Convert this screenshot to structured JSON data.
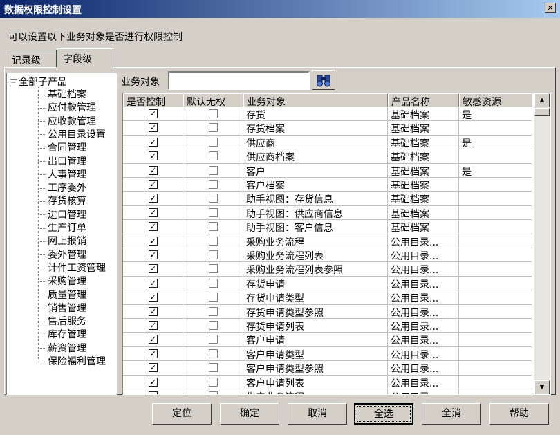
{
  "window": {
    "title": "数据权限控制设置",
    "close_glyph": "✕"
  },
  "description": "可以设置以下业务对象是否进行权限控制",
  "tabs": [
    {
      "label": "记录级"
    },
    {
      "label": "字段级"
    }
  ],
  "tree": {
    "root": "全部子产品",
    "expander": "−",
    "items": [
      "基础档案",
      "应付款管理",
      "应收款管理",
      "公用目录设置",
      "合同管理",
      "出口管理",
      "人事管理",
      "工序委外",
      "存货核算",
      "进口管理",
      "生产订单",
      "网上报销",
      "委外管理",
      "计件工资管理",
      "采购管理",
      "质量管理",
      "销售管理",
      "售后服务",
      "库存管理",
      "薪资管理",
      "保险福利管理"
    ]
  },
  "search": {
    "label": "业务对象",
    "value": "",
    "icon": "binoculars-icon"
  },
  "grid": {
    "headers": [
      "是否控制",
      "默认无权",
      "业务对象",
      "产品名称",
      "敏感资源"
    ],
    "rows": [
      {
        "control": true,
        "deny": false,
        "object": "存货",
        "product": "基础档案",
        "sensitive": "是"
      },
      {
        "control": true,
        "deny": false,
        "object": "存货档案",
        "product": "基础档案",
        "sensitive": ""
      },
      {
        "control": true,
        "deny": false,
        "object": "供应商",
        "product": "基础档案",
        "sensitive": "是"
      },
      {
        "control": true,
        "deny": false,
        "object": "供应商档案",
        "product": "基础档案",
        "sensitive": ""
      },
      {
        "control": true,
        "deny": false,
        "object": "客户",
        "product": "基础档案",
        "sensitive": "是"
      },
      {
        "control": true,
        "deny": false,
        "object": "客户档案",
        "product": "基础档案",
        "sensitive": ""
      },
      {
        "control": true,
        "deny": false,
        "object": "助手视图：存货信息",
        "product": "基础档案",
        "sensitive": ""
      },
      {
        "control": true,
        "deny": false,
        "object": "助手视图：供应商信息",
        "product": "基础档案",
        "sensitive": ""
      },
      {
        "control": true,
        "deny": false,
        "object": "助手视图：客户信息",
        "product": "基础档案",
        "sensitive": ""
      },
      {
        "control": true,
        "deny": false,
        "object": "采购业务流程",
        "product": "公用目录...",
        "sensitive": ""
      },
      {
        "control": true,
        "deny": false,
        "object": "采购业务流程列表",
        "product": "公用目录...",
        "sensitive": ""
      },
      {
        "control": true,
        "deny": false,
        "object": "采购业务流程列表参照",
        "product": "公用目录...",
        "sensitive": ""
      },
      {
        "control": true,
        "deny": false,
        "object": "存货申请",
        "product": "公用目录...",
        "sensitive": ""
      },
      {
        "control": true,
        "deny": false,
        "object": "存货申请类型",
        "product": "公用目录...",
        "sensitive": ""
      },
      {
        "control": true,
        "deny": false,
        "object": "存货申请类型参照",
        "product": "公用目录...",
        "sensitive": ""
      },
      {
        "control": true,
        "deny": false,
        "object": "存货申请列表",
        "product": "公用目录...",
        "sensitive": ""
      },
      {
        "control": true,
        "deny": false,
        "object": "客户申请",
        "product": "公用目录...",
        "sensitive": ""
      },
      {
        "control": true,
        "deny": false,
        "object": "客户申请类型",
        "product": "公用目录...",
        "sensitive": ""
      },
      {
        "control": true,
        "deny": false,
        "object": "客户申请类型参照",
        "product": "公用目录...",
        "sensitive": ""
      },
      {
        "control": true,
        "deny": false,
        "object": "客户申请列表",
        "product": "公用目录...",
        "sensitive": ""
      },
      {
        "control": true,
        "deny": false,
        "object": "生产业务流程",
        "product": "公用目录...",
        "sensitive": ""
      }
    ]
  },
  "scrollbar": {
    "up_glyph": "▲",
    "down_glyph": "▼"
  },
  "buttons": [
    {
      "label": "定位"
    },
    {
      "label": "确定"
    },
    {
      "label": "取消"
    },
    {
      "label": "全选"
    },
    {
      "label": "全消"
    },
    {
      "label": "帮助"
    }
  ],
  "check_glyph": "✓"
}
